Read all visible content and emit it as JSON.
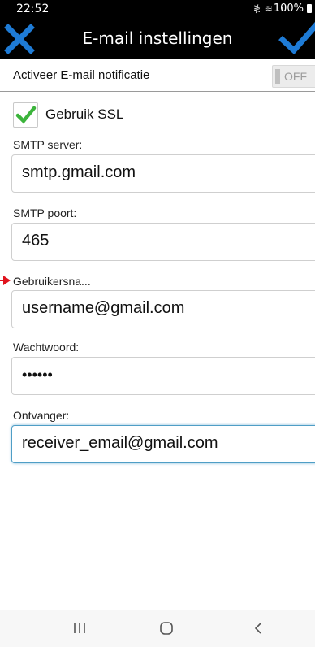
{
  "status_bar": {
    "time": "22:52",
    "signal_icons": "≹ ≋ .ıl",
    "battery": "100%"
  },
  "title_bar": {
    "title": "E-mail instellingen",
    "cancel_icon": "close-icon",
    "confirm_icon": "checkmark-icon"
  },
  "notification": {
    "label": "Activeer E-mail notificatie",
    "toggle_text": "OFF",
    "toggle_state": "off"
  },
  "ssl": {
    "label": "Gebruik SSL",
    "checked": true
  },
  "fields": {
    "smtp_server": {
      "label": "SMTP server:",
      "value": "smtp.gmail.com"
    },
    "smtp_port": {
      "label": "SMTP poort:",
      "value": "465"
    },
    "username": {
      "label": "Gebruikersna...",
      "value": "username@gmail.com"
    },
    "password": {
      "label": "Wachtwoord:",
      "value": "••••••"
    },
    "receiver": {
      "label": "Ontvanger:",
      "value": "receiver_email@gmail.com"
    }
  },
  "colors": {
    "bar_background": "#000000",
    "check_blue": "#1e7bd6",
    "ssl_check_green": "#3cb43c",
    "focus_border": "#4f9ec6",
    "annotation_arrow": "#e0141e"
  },
  "nav_bar": {
    "recents_icon": "recents-icon",
    "home_icon": "home-icon",
    "back_icon": "back-icon"
  }
}
